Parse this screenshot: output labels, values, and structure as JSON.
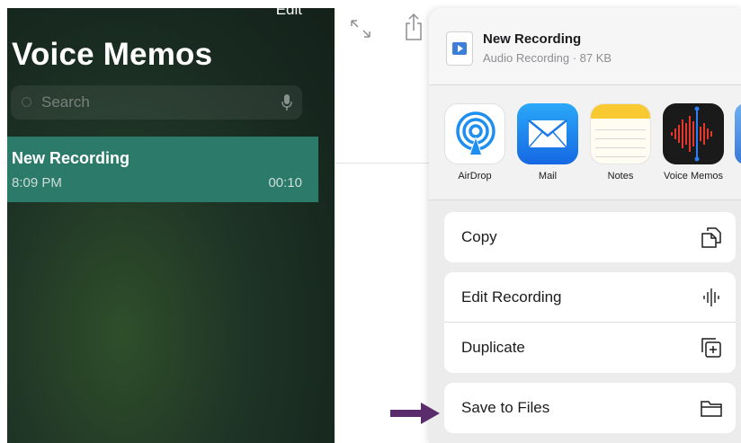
{
  "left_panel": {
    "edit_label": "Edit",
    "title": "Voice Memos",
    "search_placeholder": "Search",
    "recording": {
      "title": "New Recording",
      "time": "8:09 PM",
      "duration": "00:10"
    }
  },
  "share_sheet": {
    "file": {
      "name": "New Recording",
      "meta": "Audio Recording · 87 KB"
    },
    "apps": [
      {
        "label": "AirDrop",
        "icon": "airdrop-icon"
      },
      {
        "label": "Mail",
        "icon": "mail-icon"
      },
      {
        "label": "Notes",
        "icon": "notes-icon"
      },
      {
        "label": "Voice Memos",
        "icon": "voice-memos-icon"
      }
    ],
    "actions": {
      "copy": "Copy",
      "edit_recording": "Edit Recording",
      "duplicate": "Duplicate",
      "save_to_files": "Save to Files"
    }
  },
  "colors": {
    "selected_row": "#2c7a6a",
    "arrow": "#5b2c6b",
    "mail_blue": "#1668e3",
    "airdrop_blue": "#1f8ef1"
  }
}
